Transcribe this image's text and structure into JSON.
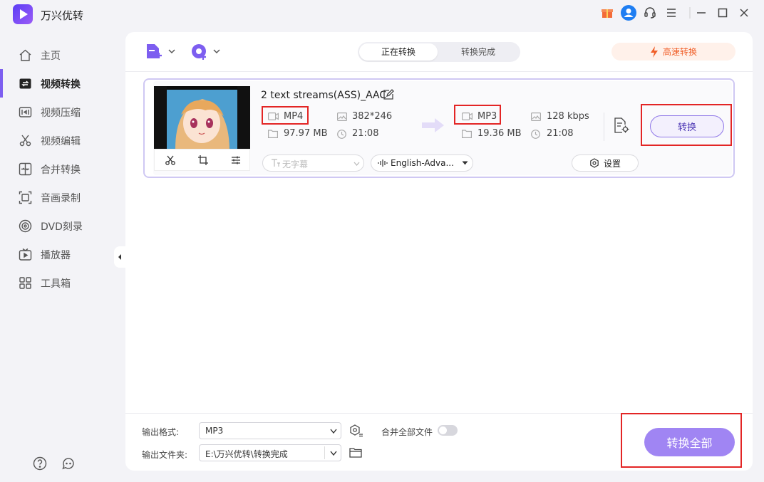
{
  "app": {
    "title": "万兴优转"
  },
  "sidebar": {
    "items": [
      {
        "label": "主页",
        "icon": "home-icon",
        "active": false
      },
      {
        "label": "视频转换",
        "icon": "convert-icon",
        "active": true
      },
      {
        "label": "视频压缩",
        "icon": "compress-icon",
        "active": false
      },
      {
        "label": "视频编辑",
        "icon": "scissors-icon",
        "active": false
      },
      {
        "label": "合并转换",
        "icon": "merge-icon",
        "active": false
      },
      {
        "label": "音画录制",
        "icon": "record-icon",
        "active": false
      },
      {
        "label": "DVD刻录",
        "icon": "dvd-icon",
        "active": false
      },
      {
        "label": "播放器",
        "icon": "player-icon",
        "active": false
      },
      {
        "label": "工具箱",
        "icon": "toolbox-icon",
        "active": false
      }
    ]
  },
  "tabs": {
    "active": "正在转换",
    "done": "转换完成"
  },
  "speed_button": "高速转换",
  "file": {
    "name": "2 text streams(ASS)_AAC",
    "source": {
      "format": "MP4",
      "resolution": "382*246",
      "size": "97.97 MB",
      "duration": "21:08"
    },
    "target": {
      "format": "MP3",
      "bitrate": "128 kbps",
      "size": "19.36 MB",
      "duration": "21:08"
    },
    "convert_label": "转换",
    "subtitle_placeholder": "无字幕",
    "audio_track": "English-Adva...",
    "settings_label": "设置"
  },
  "bottom": {
    "format_label": "输出格式:",
    "format_value": "MP3",
    "folder_label": "输出文件夹:",
    "folder_value": "E:\\万兴优转\\转换完成",
    "merge_label": "合并全部文件",
    "merge_on": false,
    "convert_all_label": "转换全部"
  },
  "colors": {
    "accent": "#7d5ef0",
    "highlight_box": "#e32525",
    "speed": "#f0602a"
  }
}
